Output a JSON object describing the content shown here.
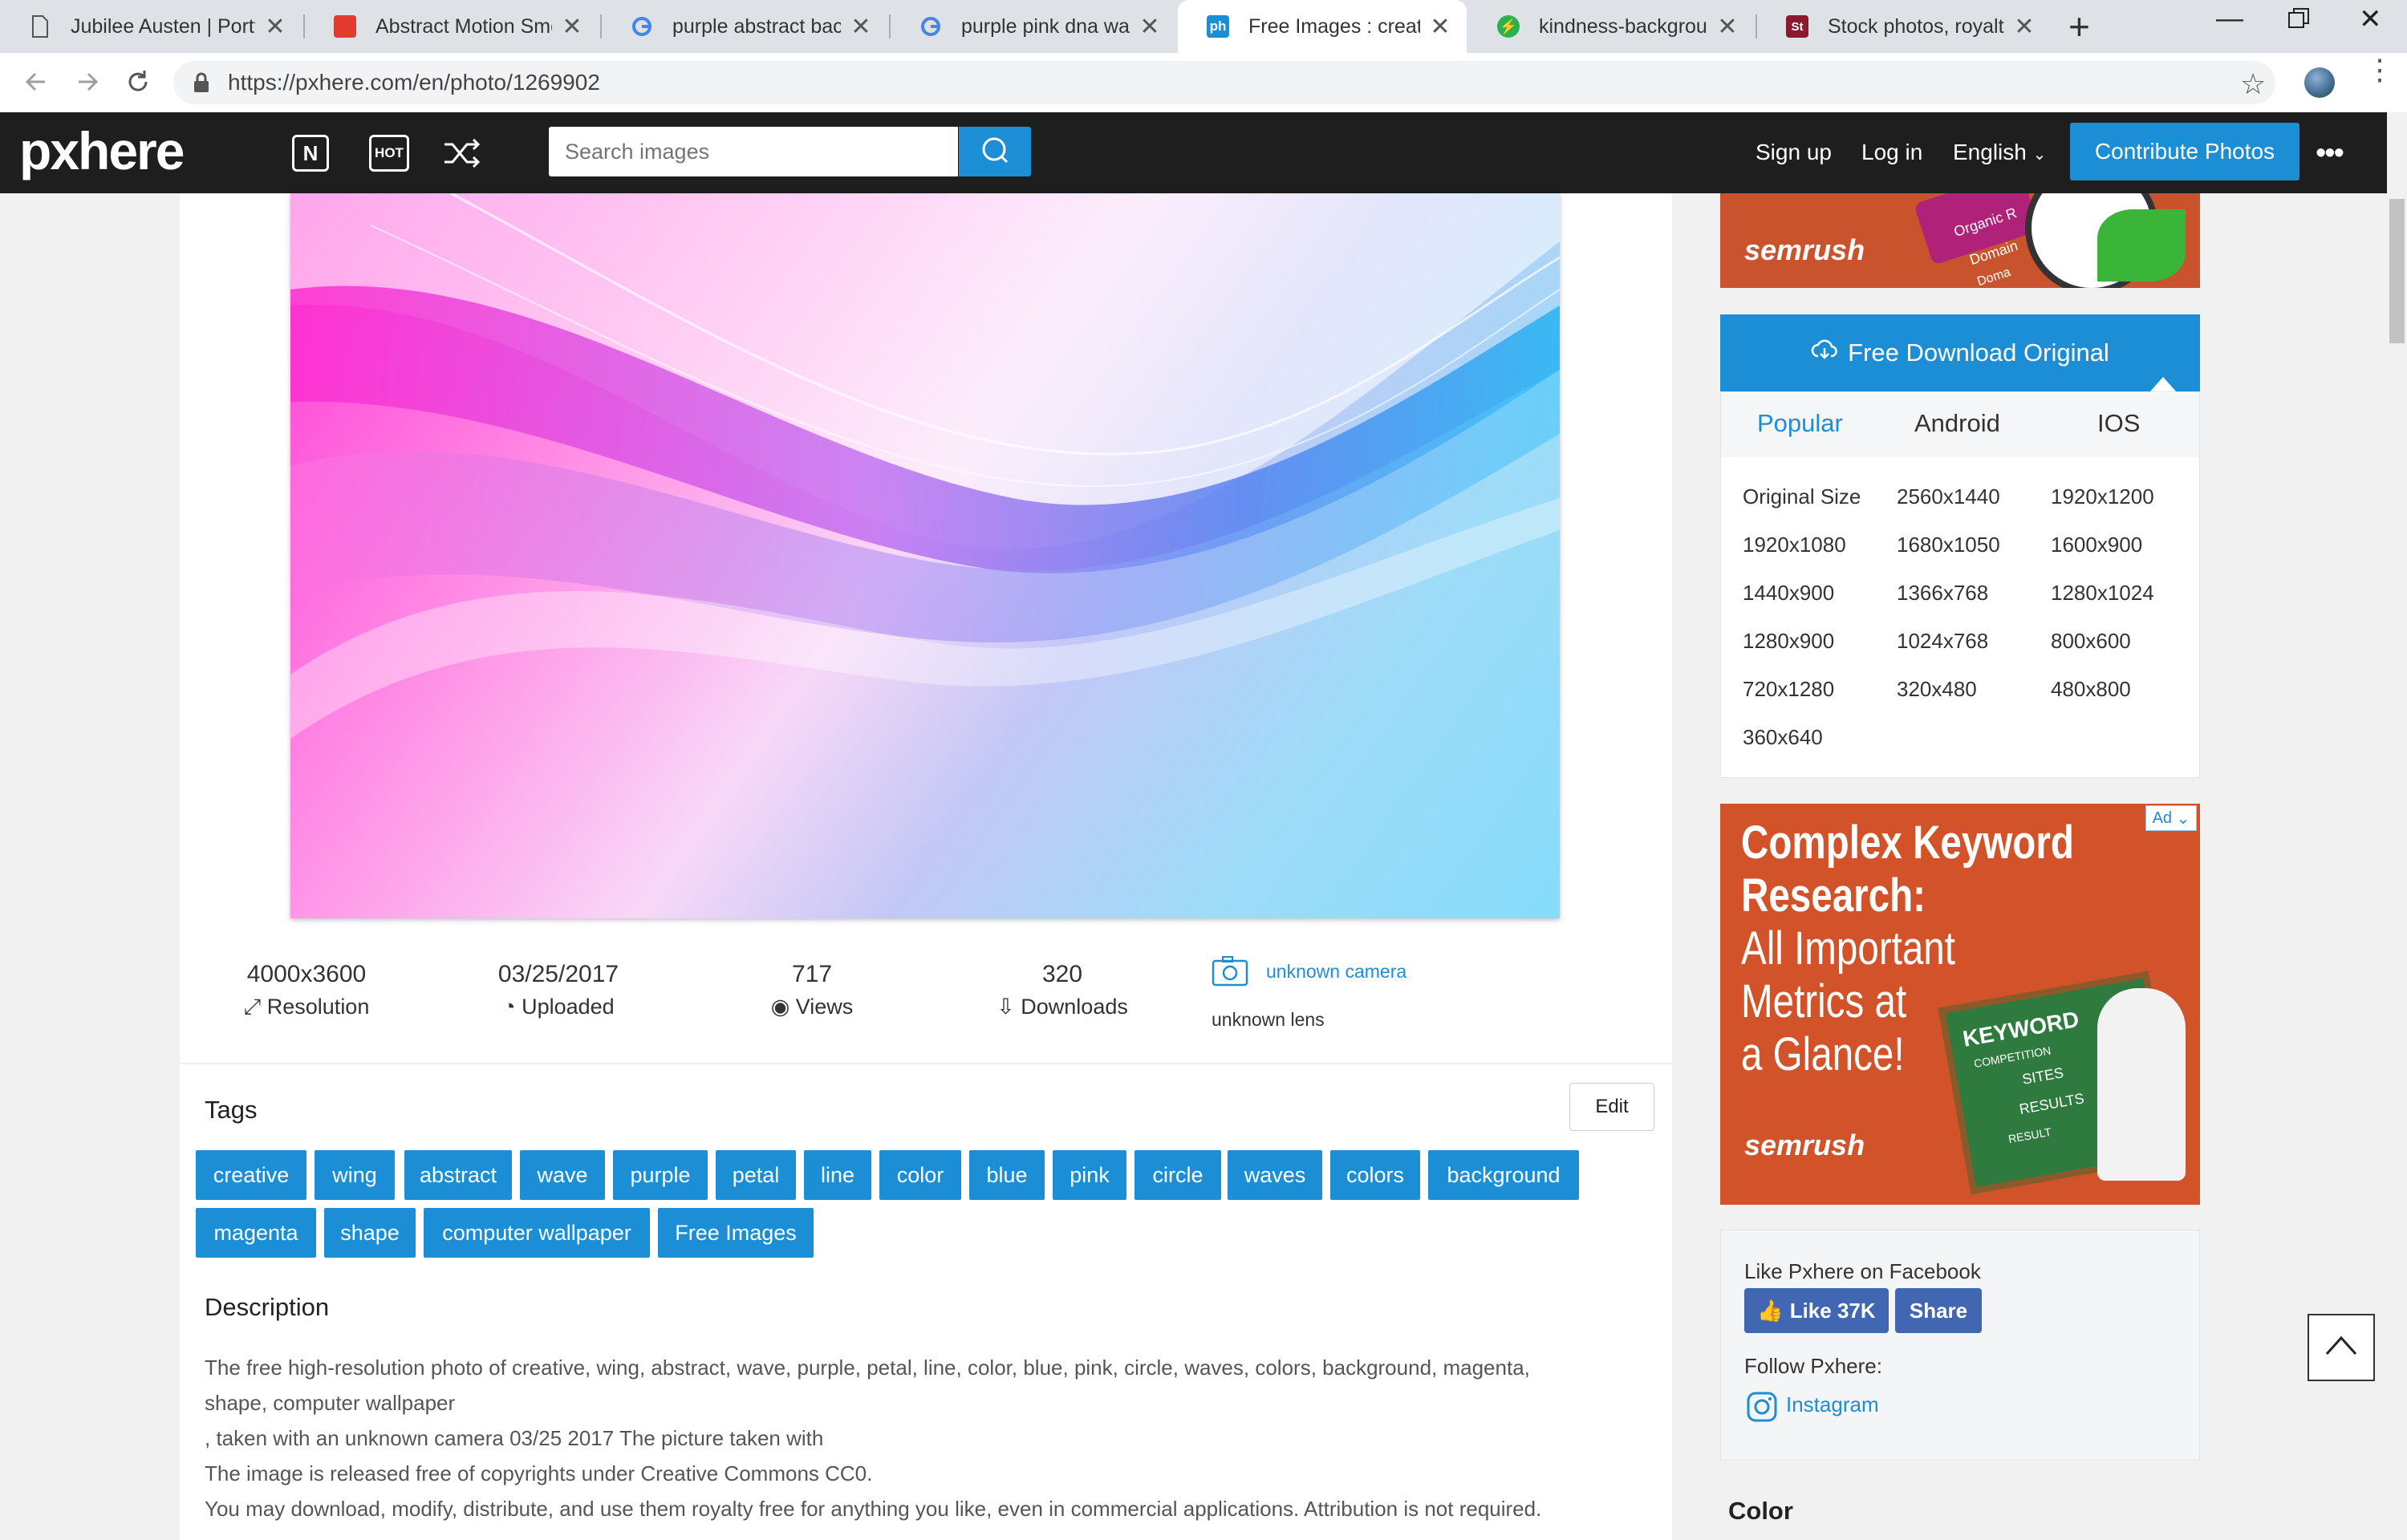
{
  "browser": {
    "tabs": [
      {
        "title": "Jubilee Austen | Portfo",
        "favicon": "document-icon"
      },
      {
        "title": "Abstract Motion Smo",
        "favicon": "red-logo-icon"
      },
      {
        "title": "purple abstract backg",
        "favicon": "google-g-icon"
      },
      {
        "title": "purple pink dna wallp",
        "favicon": "google-g-icon"
      },
      {
        "title": "Free Images : creative",
        "favicon": "pxhere-icon",
        "fav_text": "ph"
      },
      {
        "title": "kindness-background",
        "favicon": "green-bolt-icon"
      },
      {
        "title": "Stock photos, royalty-",
        "favicon": "stock-logo-icon",
        "fav_text": "St"
      }
    ],
    "url": "https://pxhere.com/en/photo/1269902"
  },
  "header": {
    "logo": "pxhere",
    "new_icon_label": "N",
    "hot_icon_label": "HOT",
    "search_placeholder": "Search images",
    "signup": "Sign up",
    "login": "Log in",
    "language": "English",
    "contribute": "Contribute Photos"
  },
  "stats": {
    "resolution_value": "4000x3600",
    "resolution_label": "Resolution",
    "uploaded_value": "03/25/2017",
    "uploaded_label": "Uploaded",
    "views_value": "717",
    "views_label": "Views",
    "downloads_value": "320",
    "downloads_label": "Downloads",
    "camera": "unknown camera",
    "lens": "unknown lens"
  },
  "tags": {
    "title": "Tags",
    "edit": "Edit",
    "items": [
      "creative",
      "wing",
      "abstract",
      "wave",
      "purple",
      "petal",
      "line",
      "color",
      "blue",
      "pink",
      "circle",
      "waves",
      "colors",
      "background",
      "magenta",
      "shape",
      "computer wallpaper",
      "Free Images"
    ]
  },
  "description": {
    "title": "Description",
    "lines": [
      "The free high-resolution photo of creative, wing, abstract, wave, purple, petal, line, color, blue, pink, circle, waves, colors, background, magenta,",
      "shape, computer wallpaper",
      ", taken with an unknown camera 03/25 2017 The picture taken with",
      "The image is released free of copyrights under Creative Commons CC0.",
      "You may download, modify, distribute, and use them royalty free for anything you like, even in commercial applications. Attribution is not required."
    ]
  },
  "download": {
    "button": "Free Download Original",
    "tabs": [
      "Popular",
      "Android",
      "IOS"
    ],
    "sizes": [
      "Original Size",
      "2560x1440",
      "1920x1200",
      "1920x1080",
      "1680x1050",
      "1600x900",
      "1440x900",
      "1366x768",
      "1280x1024",
      "1280x900",
      "1024x768",
      "800x600",
      "720x1280",
      "320x480",
      "480x800",
      "360x640"
    ]
  },
  "ads": {
    "top_brand": "semrush",
    "top_pills": [
      "Organic R",
      "Domain",
      "Doma"
    ],
    "ad_badge": "Ad",
    "headline": [
      "Complex Keyword",
      "Research:",
      "All Important",
      "Metrics at",
      "a Glance!"
    ],
    "board": [
      "KEYWORD",
      "COMPETITION",
      "SITES",
      "RESULTS",
      "RESULT"
    ],
    "brand": "semrush"
  },
  "social": {
    "like_label": "Like Pxhere on Facebook",
    "like_btn": "Like 37K",
    "share_btn": "Share",
    "follow_label": "Follow Pxhere:",
    "instagram": "Instagram"
  },
  "color_section": "Color"
}
